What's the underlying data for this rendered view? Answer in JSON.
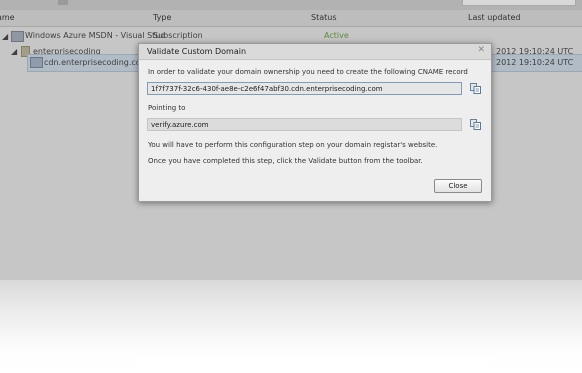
{
  "grid": {
    "columns": [
      "Name",
      "Type",
      "Status",
      "Last updated"
    ],
    "rows": [
      {
        "name": "Windows Azure MSDN - Visual Stud",
        "type": "Subscription",
        "status": "Active",
        "updated": ""
      },
      {
        "name": "enterprisecoding",
        "type": "",
        "status": "",
        "updated": "2012 19:10:24 UTC"
      },
      {
        "name": "cdn.enterprisecoding.com",
        "type": "",
        "status": "",
        "updated": "2012 19:10:24 UTC"
      }
    ]
  },
  "dialog": {
    "title": "Validate Custom Domain",
    "close_glyph": "✕",
    "instruction": "In order to validate your domain ownership you need to create the following CNAME record",
    "cname_record": "1f7f737f-32c6-430f-ae8e-c2e6f47abf30.cdn.enterprisecoding.com",
    "pointing_label": "Pointing to",
    "pointing_value": "verify.azure.com",
    "note1": "You will have to perform this configuration step on your domain registar's website.",
    "note2": "Once you have completed this step, click the Validate button from the toolbar.",
    "close_button": "Close"
  },
  "colors": {
    "overlay": "#c6c6c6",
    "dialog_bg": "#eeeeee",
    "selected_row": "#b2bcc7",
    "active_status": "#5b8a3a"
  }
}
